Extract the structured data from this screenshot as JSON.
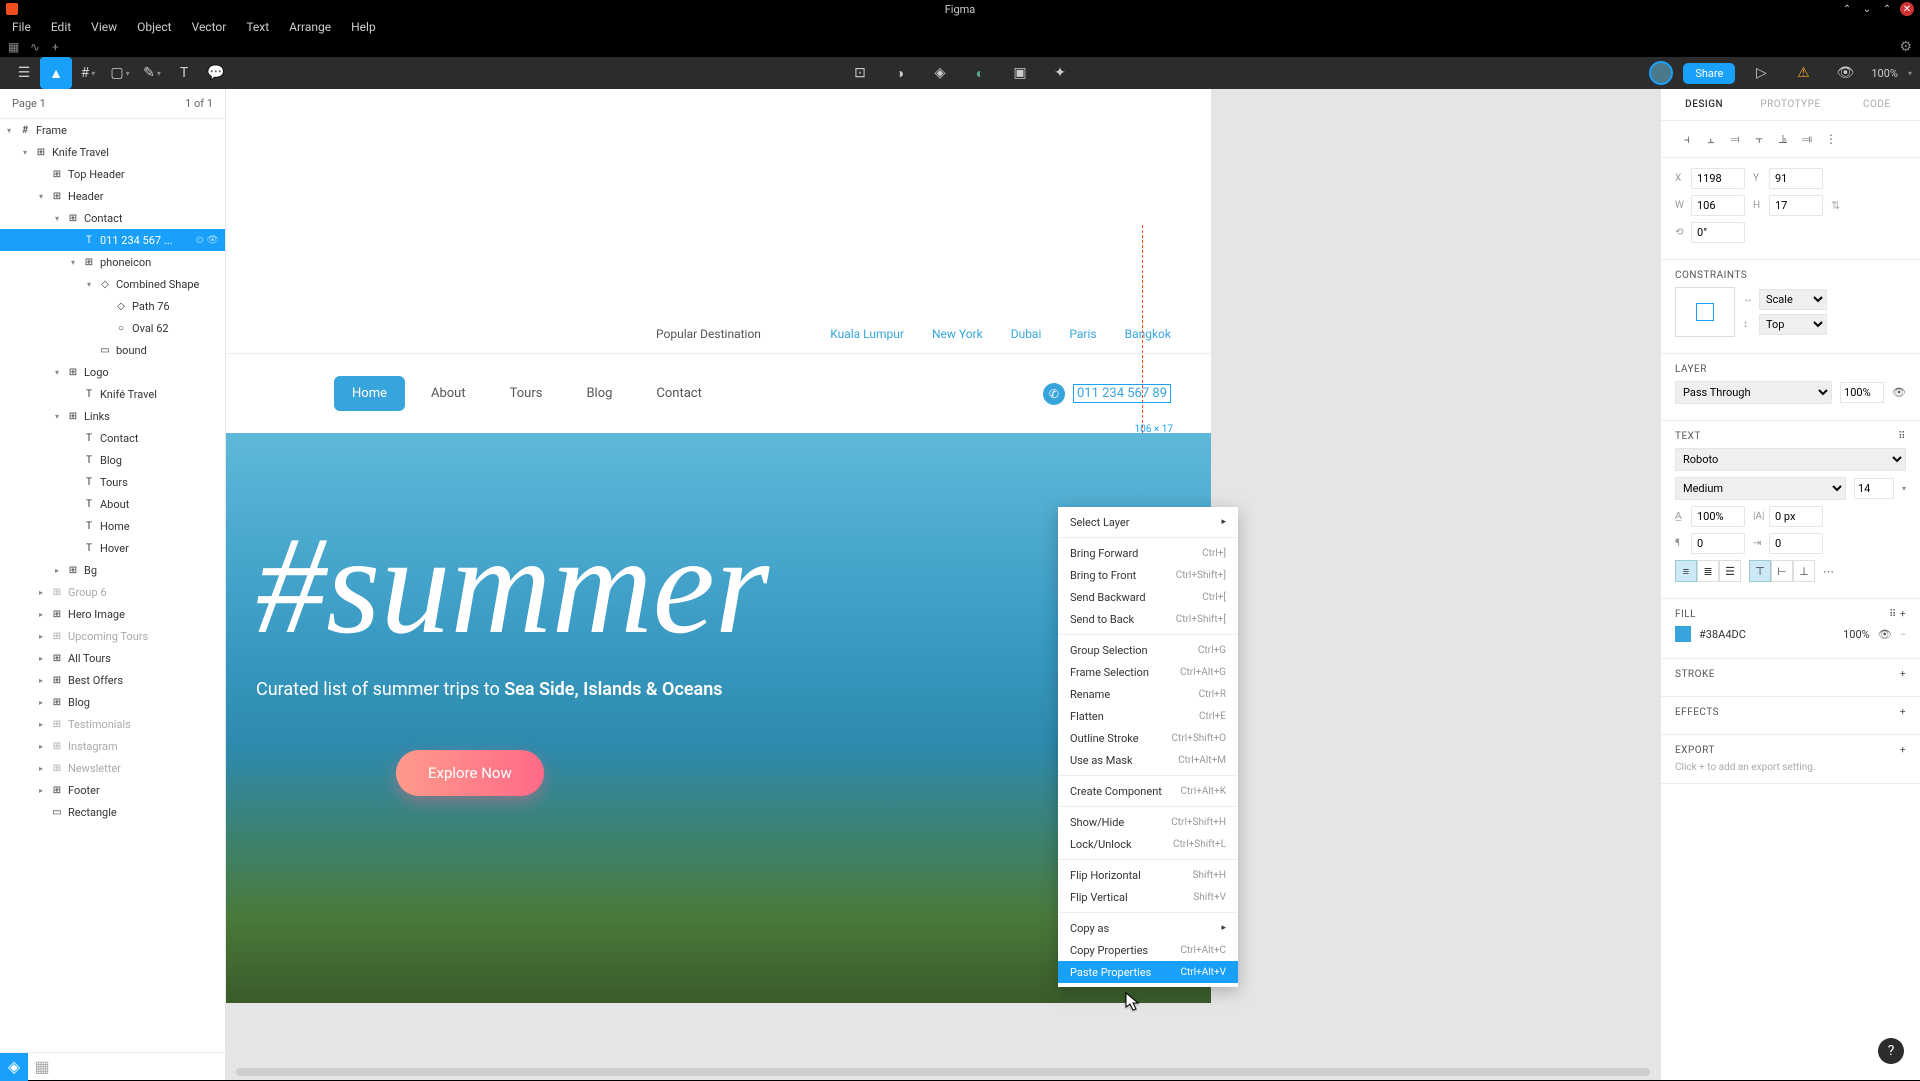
{
  "os": {
    "title": "Figma"
  },
  "menubar": [
    "File",
    "Edit",
    "View",
    "Object",
    "Vector",
    "Text",
    "Arrange",
    "Help"
  ],
  "toolbar": {
    "zoom": "100%"
  },
  "share": "Share",
  "page": {
    "name": "Page 1",
    "count": "1 of 1"
  },
  "layers": [
    {
      "pad": 0,
      "arrow": "▾",
      "icon": "#",
      "label": "Frame"
    },
    {
      "pad": 1,
      "arrow": "▾",
      "icon": "⊞",
      "label": "Knife Travel"
    },
    {
      "pad": 2,
      "arrow": "",
      "icon": "⊞",
      "label": "Top Header"
    },
    {
      "pad": 2,
      "arrow": "▾",
      "icon": "⊞",
      "label": "Header"
    },
    {
      "pad": 3,
      "arrow": "▾",
      "icon": "⊞",
      "label": "Contact"
    },
    {
      "pad": 4,
      "arrow": "",
      "icon": "T",
      "label": "011 234 567 ...",
      "selected": true,
      "vis": "⊙ 👁"
    },
    {
      "pad": 4,
      "arrow": "▾",
      "icon": "⊞",
      "label": "phoneicon"
    },
    {
      "pad": 5,
      "arrow": "▾",
      "icon": "◇",
      "label": "Combined Shape"
    },
    {
      "pad": 6,
      "arrow": "",
      "icon": "◇",
      "label": "Path 76"
    },
    {
      "pad": 6,
      "arrow": "",
      "icon": "○",
      "label": "Oval 62"
    },
    {
      "pad": 5,
      "arrow": "",
      "icon": "▭",
      "label": "bound"
    },
    {
      "pad": 3,
      "arrow": "▾",
      "icon": "⊞",
      "label": "Logo"
    },
    {
      "pad": 4,
      "arrow": "",
      "icon": "T",
      "label": "Knifé Travel"
    },
    {
      "pad": 3,
      "arrow": "▾",
      "icon": "⊞",
      "label": "Links"
    },
    {
      "pad": 4,
      "arrow": "",
      "icon": "T",
      "label": "Contact"
    },
    {
      "pad": 4,
      "arrow": "",
      "icon": "T",
      "label": "Blog"
    },
    {
      "pad": 4,
      "arrow": "",
      "icon": "T",
      "label": "Tours"
    },
    {
      "pad": 4,
      "arrow": "",
      "icon": "T",
      "label": "About"
    },
    {
      "pad": 4,
      "arrow": "",
      "icon": "T",
      "label": "Home"
    },
    {
      "pad": 4,
      "arrow": "",
      "icon": "T",
      "label": "Hover"
    },
    {
      "pad": 3,
      "arrow": "▸",
      "icon": "⊞",
      "label": "Bg"
    },
    {
      "pad": 2,
      "arrow": "▸",
      "icon": "⊞",
      "label": "Group 6",
      "dim": true
    },
    {
      "pad": 2,
      "arrow": "▸",
      "icon": "⊞",
      "label": "Hero Image"
    },
    {
      "pad": 2,
      "arrow": "▸",
      "icon": "⊞",
      "label": "Upcoming Tours",
      "dim": true
    },
    {
      "pad": 2,
      "arrow": "▸",
      "icon": "⊞",
      "label": "All Tours"
    },
    {
      "pad": 2,
      "arrow": "▸",
      "icon": "⊞",
      "label": "Best Offers"
    },
    {
      "pad": 2,
      "arrow": "▸",
      "icon": "⊞",
      "label": "Blog"
    },
    {
      "pad": 2,
      "arrow": "▸",
      "icon": "⊞",
      "label": "Testimonials",
      "dim": true
    },
    {
      "pad": 2,
      "arrow": "▸",
      "icon": "⊞",
      "label": "Instagram",
      "dim": true
    },
    {
      "pad": 2,
      "arrow": "▸",
      "icon": "⊞",
      "label": "Newsletter",
      "dim": true
    },
    {
      "pad": 2,
      "arrow": "▸",
      "icon": "⊞",
      "label": "Footer"
    },
    {
      "pad": 2,
      "arrow": "",
      "icon": "▭",
      "label": "Rectangle"
    }
  ],
  "canvas": {
    "popDestLabel": "Popular Destination",
    "destinations": [
      "Kuala Lumpur",
      "New York",
      "Dubai",
      "Paris",
      "Bangkok"
    ],
    "nav": [
      "Home",
      "About",
      "Tours",
      "Blog",
      "Contact"
    ],
    "phone": "011 234 567 89",
    "selDims": "106 × 17",
    "heroHash": "#summer",
    "heroSubPre": "Curated list of summer trips to ",
    "heroSubBold": "Sea Side, Islands & Oceans",
    "heroBtn": "Explore Now"
  },
  "ctx": [
    {
      "label": "Select Layer",
      "sc": "",
      "arrow": "▸"
    },
    {
      "sep": true
    },
    {
      "label": "Bring Forward",
      "sc": "Ctrl+]"
    },
    {
      "label": "Bring to Front",
      "sc": "Ctrl+Shift+]"
    },
    {
      "label": "Send Backward",
      "sc": "Ctrl+["
    },
    {
      "label": "Send to Back",
      "sc": "Ctrl+Shift+["
    },
    {
      "sep": true
    },
    {
      "label": "Group Selection",
      "sc": "Ctrl+G"
    },
    {
      "label": "Frame Selection",
      "sc": "Ctrl+Alt+G"
    },
    {
      "label": "Rename",
      "sc": "Ctrl+R"
    },
    {
      "label": "Flatten",
      "sc": "Ctrl+E"
    },
    {
      "label": "Outline Stroke",
      "sc": "Ctrl+Shift+O"
    },
    {
      "label": "Use as Mask",
      "sc": "Ctrl+Alt+M"
    },
    {
      "sep": true
    },
    {
      "label": "Create Component",
      "sc": "Ctrl+Alt+K"
    },
    {
      "sep": true
    },
    {
      "label": "Show/Hide",
      "sc": "Ctrl+Shift+H"
    },
    {
      "label": "Lock/Unlock",
      "sc": "Ctrl+Shift+L"
    },
    {
      "sep": true
    },
    {
      "label": "Flip Horizontal",
      "sc": "Shift+H"
    },
    {
      "label": "Flip Vertical",
      "sc": "Shift+V"
    },
    {
      "sep": true
    },
    {
      "label": "Copy as",
      "sc": "",
      "arrow": "▸"
    },
    {
      "label": "Copy Properties",
      "sc": "Ctrl+Alt+C"
    },
    {
      "label": "Paste Properties",
      "sc": "Ctrl+Alt+V",
      "hovered": true
    }
  ],
  "props": {
    "tabs": [
      "DESIGN",
      "PROTOTYPE",
      "CODE"
    ],
    "x": "1198",
    "y": "91",
    "w": "106",
    "h": "17",
    "rot": "0°",
    "constraintSection": "CONSTRAINTS",
    "constraintH": "Scale",
    "constraintV": "Top",
    "layerSection": "LAYER",
    "blend": "Pass Through",
    "opacity": "100%",
    "textSection": "TEXT",
    "font": "Roboto",
    "weight": "Medium",
    "size": "14",
    "lineHeight": "100%",
    "letterSpacing": "0 px",
    "para": "0",
    "indent": "0",
    "fillSection": "FILL",
    "fillHex": "#38A4DC",
    "fillOpacity": "100%",
    "strokeSection": "STROKE",
    "effectsSection": "EFFECTS",
    "exportSection": "EXPORT",
    "exportHint": "Click + to add an export setting."
  }
}
